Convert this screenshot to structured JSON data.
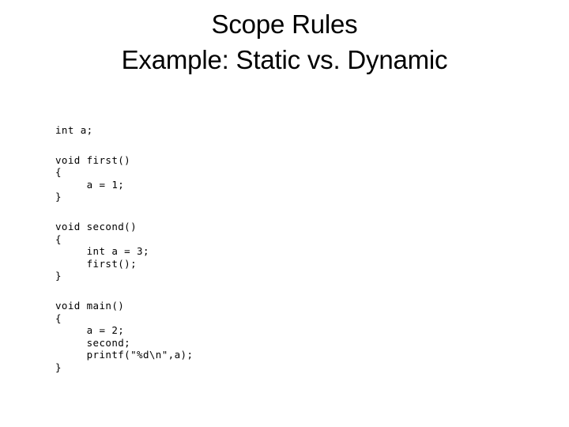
{
  "slide": {
    "background_color": "#ffffff",
    "text_color": "#000000",
    "title": {
      "line1": "Scope Rules",
      "line2": "Example: Static vs. Dynamic"
    },
    "code": {
      "blocks": [
        {
          "name": "global-declaration",
          "lines": [
            "int a;"
          ]
        },
        {
          "name": "function-first",
          "lines": [
            "void first()",
            "{",
            "     a = 1;",
            "}"
          ]
        },
        {
          "name": "function-second",
          "lines": [
            "void second()",
            "{",
            "     int a = 3;",
            "     first();",
            "}"
          ]
        },
        {
          "name": "function-main",
          "lines": [
            "void main()",
            "{",
            "     a = 2;",
            "     second;",
            "     printf(\"%d\\n\",a);",
            "}"
          ]
        }
      ]
    }
  }
}
